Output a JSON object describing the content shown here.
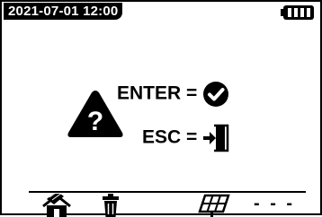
{
  "status_bar": {
    "datetime": "2021-07-01 12:00",
    "battery_icon": "battery-full-icon"
  },
  "dialog": {
    "icon": "warning-question-icon",
    "enter_label": "ENTER =",
    "enter_icon": "check-circle-icon",
    "esc_label": "ESC =",
    "esc_icon": "exit-door-icon"
  },
  "toolbar": {
    "items": [
      {
        "icon": "house-solar-icon"
      },
      {
        "icon": "trash-icon"
      },
      {
        "icon": "solar-panel-icon"
      },
      {
        "label": "- - -"
      }
    ]
  },
  "colors": {
    "foreground": "#000000",
    "background": "#ffffff"
  }
}
